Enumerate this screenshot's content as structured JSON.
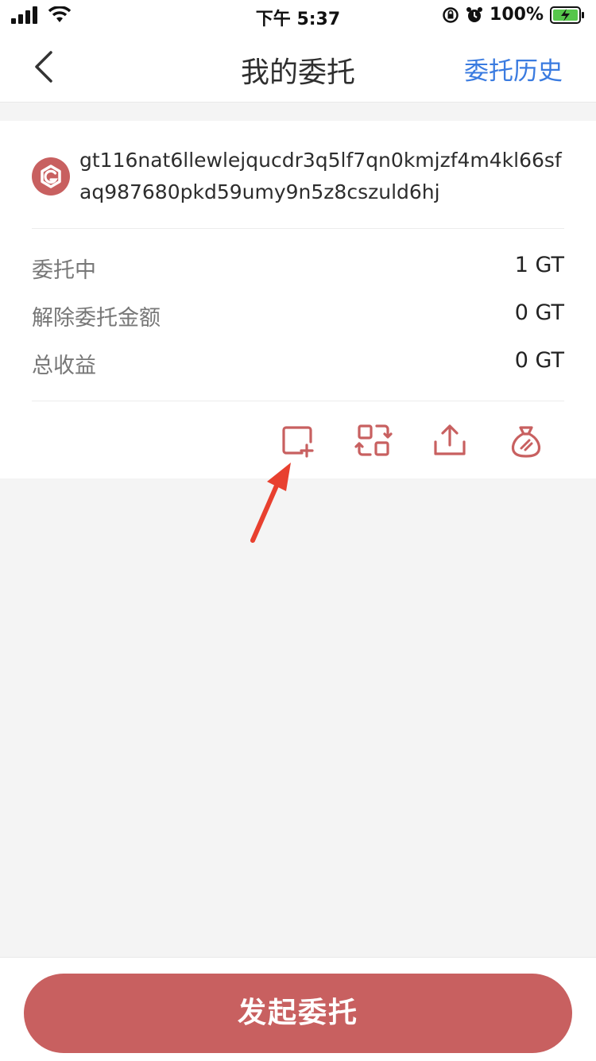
{
  "status_bar": {
    "time": "下午 5:37",
    "battery_percent": "100%"
  },
  "nav": {
    "title": "我的委托",
    "action_label": "委托历史"
  },
  "node": {
    "address": "gt116nat6llewlejqucdr3q5lf7qn0kmjzf4m4kl66sfaq987680pkd59umy9n5z8cszuld6hj"
  },
  "stats": [
    {
      "label": "委托中",
      "value": "1 GT"
    },
    {
      "label": "解除委托金额",
      "value": "0 GT"
    },
    {
      "label": "总收益",
      "value": "0 GT"
    }
  ],
  "actions": {
    "icons": [
      "add-delegation-icon",
      "redelegate-icon",
      "undelegate-icon",
      "claim-rewards-icon"
    ]
  },
  "primary_button": {
    "label": "发起委托"
  },
  "colors": {
    "accent": "#c86060",
    "link": "#3a7be0",
    "pointer_arrow": "#e8402f"
  }
}
